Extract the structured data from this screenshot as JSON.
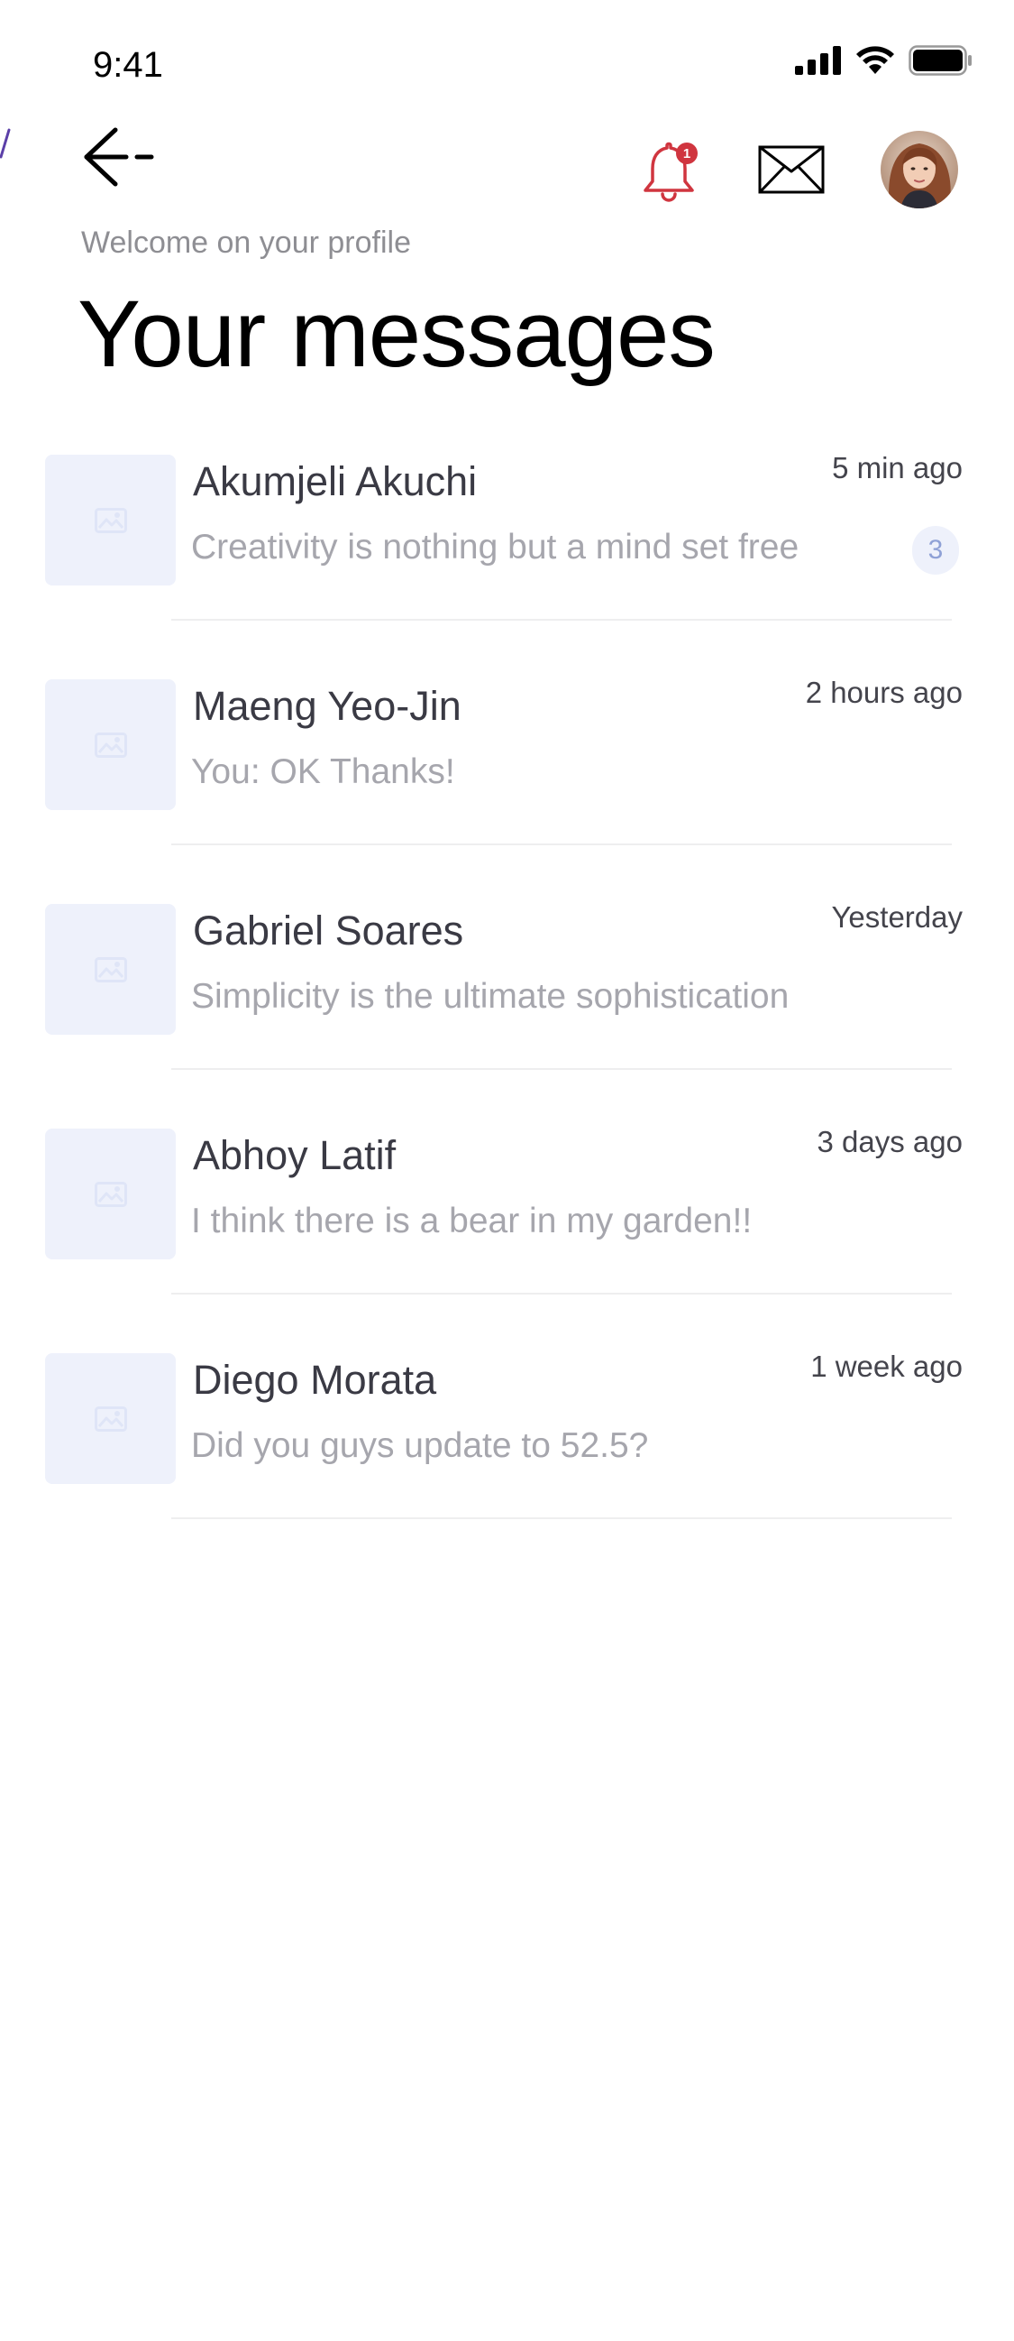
{
  "status_bar": {
    "time": "9:41"
  },
  "header": {
    "notification_count": "1",
    "welcome": "Welcome on your profile",
    "title": "Your messages"
  },
  "conversations": [
    {
      "name": "Akumjeli Akuchi",
      "preview": "Creativity is nothing but a mind set free",
      "time": "5 min ago",
      "unread": "3"
    },
    {
      "name": "Maeng Yeo-Jin",
      "preview": "You: OK Thanks!",
      "time": "2 hours ago"
    },
    {
      "name": "Gabriel Soares",
      "preview": "Simplicity is the ultimate sophistication",
      "time": "Yesterday"
    },
    {
      "name": "Abhoy Latif",
      "preview": "I think there is a bear in my garden!!",
      "time": "3 days ago"
    },
    {
      "name": "Diego Morata",
      "preview": "Did you guys update to 52.5?",
      "time": "1 week ago"
    }
  ],
  "icons": {
    "back": "arrow-left-icon",
    "bell": "bell-icon",
    "mail": "mail-icon",
    "thumbnail": "image-placeholder-icon",
    "signal": "cellular-signal-icon",
    "wifi": "wifi-icon",
    "battery": "battery-icon"
  },
  "colors": {
    "accent_red": "#d0353f",
    "placeholder_bg": "#eef1fb",
    "placeholder_icon": "#dfe5f7",
    "badge_text": "#8fa1d6",
    "edge_mark": "#5b3fa8"
  }
}
